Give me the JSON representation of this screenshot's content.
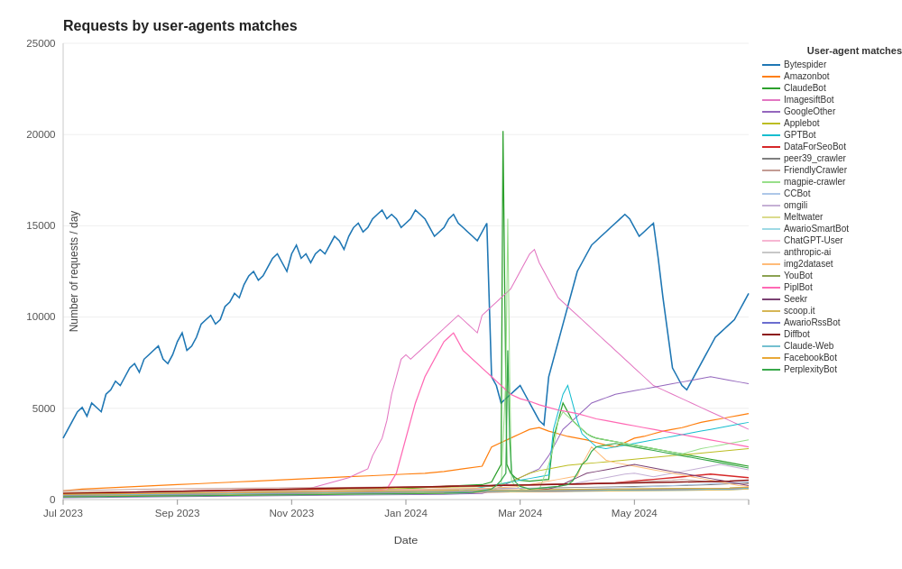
{
  "title": "Requests by user-agents matches",
  "yLabel": "Number of requests / day",
  "xLabel": "Date",
  "xTicks": [
    "Jul 2023",
    "Sep 2023",
    "Nov 2023",
    "Jan 2024",
    "Mar 2024",
    "May 2024"
  ],
  "legend": {
    "title": "User-agent matches",
    "items": [
      {
        "label": "Bytespider",
        "color": "#1f77b4"
      },
      {
        "label": "Amazonbot",
        "color": "#ff7f0e"
      },
      {
        "label": "ClaudeBot",
        "color": "#2ca02c"
      },
      {
        "label": "ImagesiftBot",
        "color": "#e377c2"
      },
      {
        "label": "GoogleOther",
        "color": "#9467bd"
      },
      {
        "label": "Applebot",
        "color": "#bcbd22"
      },
      {
        "label": "GPTBot",
        "color": "#17becf"
      },
      {
        "label": "DataForSeoBot",
        "color": "#d62728"
      },
      {
        "label": "peer39_crawler",
        "color": "#7f7f7f"
      },
      {
        "label": "FriendlyCrawler",
        "color": "#c49c94"
      },
      {
        "label": "magpie-crawler",
        "color": "#98df8a"
      },
      {
        "label": "CCBot",
        "color": "#aec7e8"
      },
      {
        "label": "omgili",
        "color": "#c5b0d5"
      },
      {
        "label": "Meltwater",
        "color": "#dbdb8d"
      },
      {
        "label": "AwarioSmartBot",
        "color": "#9edae5"
      },
      {
        "label": "ChatGPT-User",
        "color": "#f7b6d2"
      },
      {
        "label": "anthropic-ai",
        "color": "#c7c7c7"
      },
      {
        "label": "img2dataset",
        "color": "#ffbb78"
      },
      {
        "label": "YouBot",
        "color": "#8ca252"
      },
      {
        "label": "PiplBot",
        "color": "#ff69b4"
      },
      {
        "label": "Seekr",
        "color": "#7b4173"
      },
      {
        "label": "scoop.it",
        "color": "#d6b656"
      },
      {
        "label": "AwarioRssBot",
        "color": "#6b6ecf"
      },
      {
        "label": "Diffbot",
        "color": "#8c1515"
      },
      {
        "label": "Claude-Web",
        "color": "#74c0d0"
      },
      {
        "label": "FacebookBot",
        "color": "#e8a838"
      },
      {
        "label": "PerplexityBot",
        "color": "#39a84b"
      }
    ]
  }
}
